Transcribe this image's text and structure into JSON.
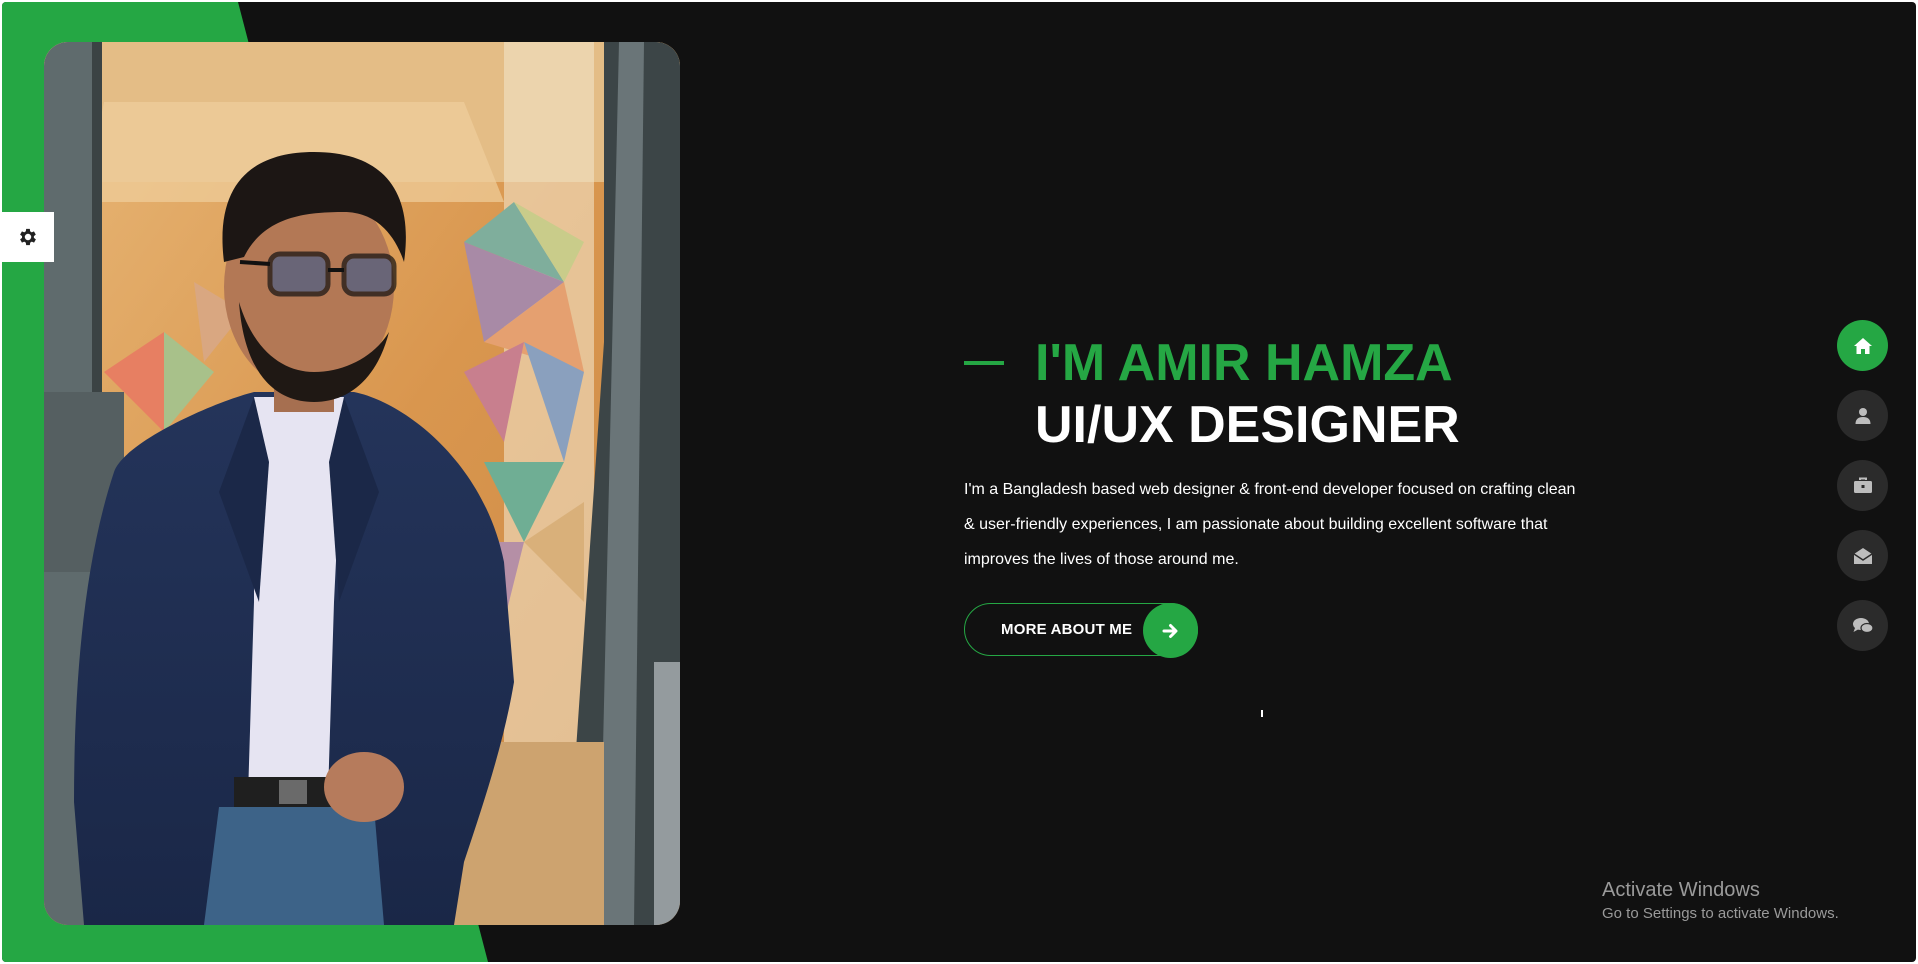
{
  "hero": {
    "greeting": "I'M AMIR HAMZA",
    "role": "UI/UX DESIGNER",
    "description": "I'm a Bangladesh based web designer & front-end developer focused on crafting clean & user-friendly experiences, I am passionate about building excellent software that improves the lives of those around me.",
    "cta_label": "MORE ABOUT ME"
  },
  "sidenav": {
    "items": [
      {
        "name": "home",
        "icon": "home-icon",
        "active": true
      },
      {
        "name": "about",
        "icon": "user-icon",
        "active": false
      },
      {
        "name": "portfolio",
        "icon": "briefcase-icon",
        "active": false
      },
      {
        "name": "contact",
        "icon": "envelope-open-icon",
        "active": false
      },
      {
        "name": "blog",
        "icon": "comments-icon",
        "active": false
      }
    ]
  },
  "settings": {
    "icon": "gear-icon"
  },
  "os_watermark": {
    "title": "Activate Windows",
    "subtitle": "Go to Settings to activate Windows."
  },
  "colors": {
    "accent": "#25a744",
    "background": "#111111",
    "nav_inactive": "#2b2b2b",
    "text": "#ffffff"
  }
}
